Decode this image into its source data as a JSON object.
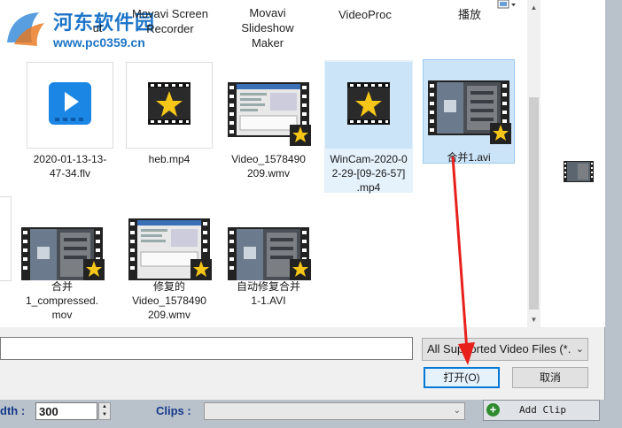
{
  "top_captions": [
    {
      "text": "ut"
    },
    {
      "text": "Movavi Screen\nRecorder"
    },
    {
      "text": "Movavi\nSlideshow\nMaker"
    },
    {
      "text": "VideoProc"
    },
    {
      "text": "播放"
    }
  ],
  "watermark": {
    "title": "河东软件园",
    "url": "www.pc0359.cn"
  },
  "files_row1": [
    {
      "name": "2020-01-13-13-\n47-34.flv",
      "kind": "flv"
    },
    {
      "name": "heb.mp4",
      "kind": "star"
    },
    {
      "name": "Video_1578490\n209.wmv",
      "kind": "film-screen"
    },
    {
      "name": "WinCam-2020-0\n2-29-[09-26-57]\n.mp4",
      "kind": "star",
      "selected": true
    },
    {
      "name": "合并1.avi",
      "kind": "film-photo",
      "selected": true
    }
  ],
  "files_row2": [
    {
      "name": "合并\n1_compressed.\nmov",
      "kind": "film-photo"
    },
    {
      "name": "修复的\nVideo_1578490\n209.wmv",
      "kind": "film-screen"
    },
    {
      "name": "自动修复合并\n1-1.AVI",
      "kind": "film-photo"
    }
  ],
  "file_type_select": {
    "value": "All Supported Video Files (*."
  },
  "open_button": {
    "label": "打开(O)"
  },
  "cancel_button": {
    "label": "取消"
  },
  "app": {
    "width_label": "dth :",
    "width_value": "300",
    "clips_label": "Clips :",
    "add_clip_label": "Add Clip"
  },
  "colors": {
    "accent": "#0078d7",
    "arrow": "#e8201c",
    "selection": "#cce4f7"
  }
}
